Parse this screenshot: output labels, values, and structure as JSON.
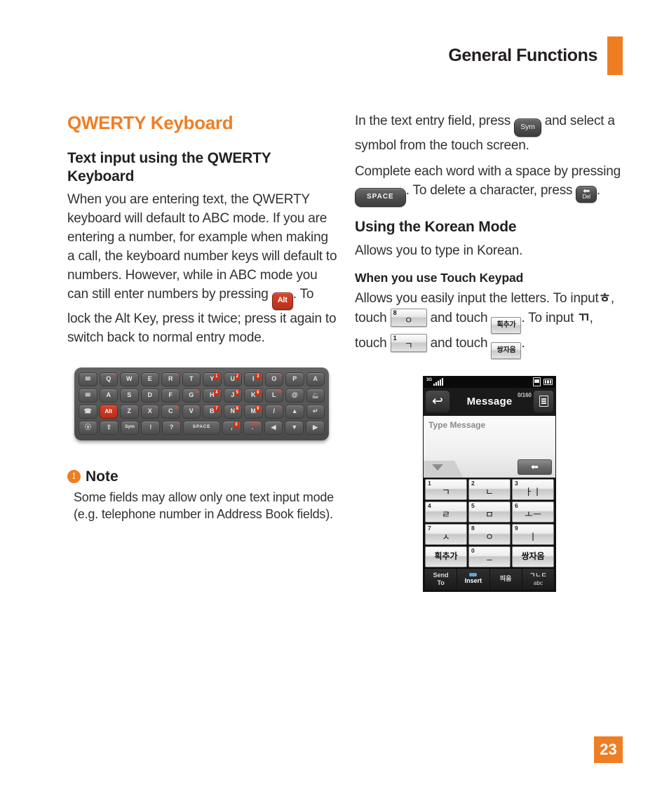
{
  "header": {
    "title": "General Functions",
    "accent_color": "#ef7e23"
  },
  "page_number": "23",
  "left_column": {
    "section_title": "QWERTY Keyboard",
    "subheading": "Text input using the QWERTY Keyboard",
    "paragraph_1a": "When you are entering text, the QWERTY keyboard will default to ABC mode. If you are entering a number, for example when making a call, the keyboard number keys will default to numbers. However, while in ABC mode you can still enter numbers by pressing",
    "inline_key_alt": "Alt",
    "paragraph_1b": ". To lock the Alt Key, press it twice; press it again to switch back to normal entry mode.",
    "note": {
      "icon": "exclamation-icon",
      "title": "Note",
      "body": "Some fields may allow only one text input mode (e.g. telephone number in Address Book fields)."
    },
    "keyboard_image": {
      "name": "qwerty-keyboard-diagram",
      "rows": [
        [
          {
            "label": "✉",
            "alt": "",
            "type": "icon",
            "name": "message-key"
          },
          {
            "label": "Q",
            "alt": "^",
            "type": "letter"
          },
          {
            "label": "W",
            "alt": "~",
            "type": "letter"
          },
          {
            "label": "E",
            "alt": "–",
            "type": "letter"
          },
          {
            "label": "R",
            "alt": "=",
            "type": "letter"
          },
          {
            "label": "T",
            "alt": "+",
            "type": "letter"
          },
          {
            "label": "Y",
            "alt": "1",
            "type": "letter",
            "boxed": true
          },
          {
            "label": "U",
            "alt": "2",
            "type": "letter",
            "boxed": true
          },
          {
            "label": "I",
            "alt": "3",
            "type": "letter",
            "boxed": true
          },
          {
            "label": "O",
            "alt": "(",
            "type": "letter"
          },
          {
            "label": "P",
            "alt": ")",
            "type": "letter"
          },
          {
            "label": "὜A",
            "alt": "",
            "type": "icon",
            "name": "compose-key"
          }
        ],
        [
          {
            "label": "✉",
            "alt": "",
            "type": "icon",
            "name": "email-key"
          },
          {
            "label": "A",
            "alt": ":",
            "type": "letter"
          },
          {
            "label": "S",
            "alt": ";",
            "type": "letter"
          },
          {
            "label": "D",
            "alt": "'",
            "type": "letter"
          },
          {
            "label": "F",
            "alt": "_",
            "type": "letter"
          },
          {
            "label": "G",
            "alt": "$",
            "type": "letter"
          },
          {
            "label": "H",
            "alt": "4",
            "type": "letter",
            "boxed": true
          },
          {
            "label": "J",
            "alt": "5",
            "type": "letter",
            "boxed": true
          },
          {
            "label": "K",
            "alt": "6",
            "type": "letter",
            "boxed": true
          },
          {
            "label": "L",
            "alt": "%",
            "type": "letter"
          },
          {
            "label": "@",
            "alt": "\\",
            "type": "letter"
          },
          {
            "label": "Del",
            "alt": "",
            "type": "del",
            "name": "delete-key"
          }
        ],
        [
          {
            "label": "☎",
            "alt": "",
            "type": "icon",
            "name": "contacts-key"
          },
          {
            "label": "Alt",
            "alt": "",
            "type": "alt",
            "name": "alt-key"
          },
          {
            "label": "Z",
            "alt": "<",
            "type": "letter"
          },
          {
            "label": "X",
            "alt": ">",
            "type": "letter"
          },
          {
            "label": "C",
            "alt": "&",
            "type": "letter"
          },
          {
            "label": "V",
            "alt": "×",
            "type": "letter"
          },
          {
            "label": "B",
            "alt": "7",
            "type": "letter",
            "boxed": true
          },
          {
            "label": "N",
            "alt": "8",
            "type": "letter",
            "boxed": true
          },
          {
            "label": "M",
            "alt": "9",
            "type": "letter",
            "boxed": true
          },
          {
            "label": "/",
            "alt": "#",
            "type": "letter"
          },
          {
            "label": "▲",
            "alt": "",
            "type": "icon",
            "name": "up-arrow-key"
          },
          {
            "label": "↵",
            "alt": "",
            "type": "icon",
            "name": "enter-key"
          }
        ],
        [
          {
            "label": "ⓐ",
            "alt": "",
            "type": "icon",
            "name": "att-key"
          },
          {
            "label": "⇧",
            "alt": "",
            "type": "icon",
            "name": "shift-key"
          },
          {
            "label": "Sym",
            "alt": "",
            "type": "sym",
            "name": "sym-key"
          },
          {
            "label": "!",
            "alt": "~",
            "type": "letter"
          },
          {
            "label": "?",
            "alt": "*",
            "type": "letter"
          },
          {
            "label": "SPACE",
            "alt": "",
            "type": "space",
            "name": "space-key"
          },
          {
            "label": ",",
            "alt": "0",
            "type": "letter",
            "boxed": true
          },
          {
            "label": ".",
            "alt": ".com",
            "type": "letter"
          },
          {
            "label": "◀",
            "alt": "",
            "type": "icon",
            "name": "left-arrow-key"
          },
          {
            "label": "▼",
            "alt": "",
            "type": "icon",
            "name": "down-arrow-key"
          },
          {
            "label": "▶",
            "alt": "",
            "type": "icon",
            "name": "right-arrow-key"
          }
        ]
      ]
    }
  },
  "right_column": {
    "paragraph_1a": "In the text entry field, press",
    "inline_key_sym": "Sym",
    "paragraph_1b": "and select a symbol from the touch screen.",
    "paragraph_2a": "Complete each word with a space by pressing",
    "inline_key_space": "SPACE",
    "paragraph_2b": ". To delete a character, press",
    "inline_key_del": "Del",
    "paragraph_2c": ".",
    "korean_heading": "Using the Korean Mode",
    "korean_intro": "Allows you to type in Korean.",
    "touch_heading": "When you use Touch Keypad",
    "touch_body_a": "Allows you easily input the letters. To input",
    "letter_h": "ㅎ",
    "touch_body_b": ", touch",
    "chip_8_num": "8",
    "chip_8_glyph": "ㅇ",
    "touch_body_c": "and touch",
    "chip_hoek": "획추가",
    "touch_body_d": ". To input",
    "letter_gg": "ㄲ",
    "touch_body_e": ", touch",
    "chip_1_num": "1",
    "chip_1_glyph": "ㄱ",
    "touch_body_f": "and touch",
    "chip_ssang": "쌍자음",
    "touch_body_g": ".",
    "phone": {
      "name": "korean-keypad-phone-screenshot",
      "status_bar": {
        "network": "3G",
        "signal": "signal-icon",
        "device": "device-icon",
        "battery": "battery-icon"
      },
      "title": "Message",
      "char_count": "0/160",
      "back_icon": "back-arrow-icon",
      "menu_icon": "menu-list-icon",
      "placeholder": "Type Message",
      "backspace_icon": "backspace-arrow-icon",
      "expand_icon": "expand-down-icon",
      "keys": [
        [
          {
            "num": "1",
            "glyph": "ㄱ"
          },
          {
            "num": "2",
            "glyph": "ㄴ"
          },
          {
            "num": "3",
            "glyph": "ㅏㅣ"
          }
        ],
        [
          {
            "num": "4",
            "glyph": "ㄹ"
          },
          {
            "num": "5",
            "glyph": "ㅁ"
          },
          {
            "num": "6",
            "glyph": "ㅗㅡ"
          }
        ],
        [
          {
            "num": "7",
            "glyph": "ㅅ"
          },
          {
            "num": "8",
            "glyph": "ㅇ"
          },
          {
            "num": "9",
            "glyph": "ㅣ"
          }
        ]
      ],
      "keys_bottom": [
        {
          "num": "",
          "word": "획추가"
        },
        {
          "num": "0",
          "glyph": "–"
        },
        {
          "num": "",
          "word": "쌍자음"
        }
      ],
      "softkeys": [
        {
          "line1": "Send",
          "line2": "To",
          "name": "send-to-softkey"
        },
        {
          "line1": "Insert",
          "line2": "",
          "name": "insert-softkey"
        },
        {
          "line1": "띄움",
          "line2": "",
          "name": "space-softkey"
        },
        {
          "line1": "ㄱㄴㄷ",
          "line2": "abc",
          "name": "mode-softkey"
        }
      ]
    }
  }
}
